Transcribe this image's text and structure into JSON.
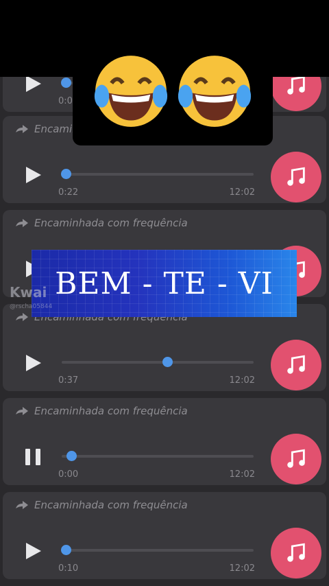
{
  "messages": [
    {
      "forward_label": "",
      "current_time": "0:0",
      "total_time": "",
      "progress": 0.02,
      "state": "play"
    },
    {
      "forward_label": "Encaminhada com frequência",
      "current_time": "0:22",
      "total_time": "12:02",
      "progress": 0.02,
      "state": "play"
    },
    {
      "forward_label": "Encaminhada com frequência",
      "current_time": "",
      "total_time": "",
      "progress": 0.0,
      "state": "play"
    },
    {
      "forward_label": "Encaminhada com frequência",
      "current_time": "0:37",
      "total_time": "12:02",
      "progress": 0.55,
      "state": "play"
    },
    {
      "forward_label": "Encaminhada com frequência",
      "current_time": "0:00",
      "total_time": "12:02",
      "progress": 0.05,
      "state": "pause"
    },
    {
      "forward_label": "Encaminhada com frequência",
      "current_time": "0:10",
      "total_time": "12:02",
      "progress": 0.02,
      "state": "play"
    }
  ],
  "banner": {
    "text": "BEM - TE - VI"
  },
  "watermark": {
    "brand": "Kwai",
    "handle": "@rscha05844"
  },
  "emoji": {
    "name": "face-with-tears-of-joy",
    "count": 2
  },
  "colors": {
    "music_button": "#e2516f",
    "knob": "#4f96e8",
    "card": "#39383c",
    "banner": "#2433bd"
  }
}
